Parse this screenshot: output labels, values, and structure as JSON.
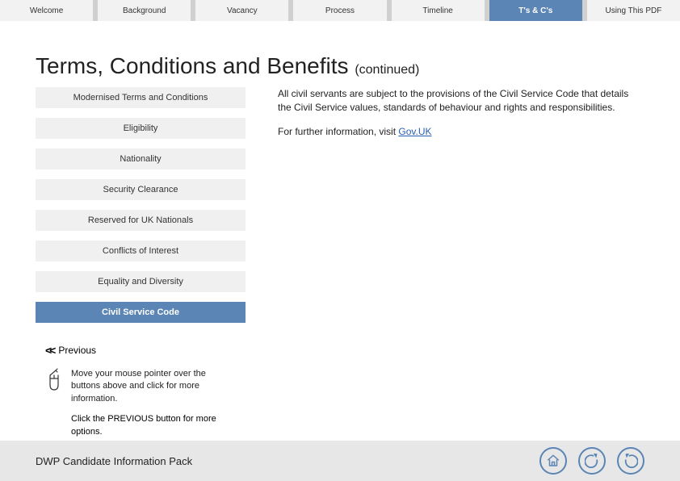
{
  "nav": {
    "tabs": [
      {
        "label": "Welcome"
      },
      {
        "label": "Background"
      },
      {
        "label": "Vacancy"
      },
      {
        "label": "Process"
      },
      {
        "label": "Timeline"
      },
      {
        "label": "T's & C's"
      },
      {
        "label": "Using This PDF"
      }
    ],
    "activeIndex": 5
  },
  "title": "Terms, Conditions and Benefits",
  "titleSuffix": "(continued)",
  "side": {
    "items": [
      {
        "label": "Modernised Terms and Conditions"
      },
      {
        "label": "Eligibility"
      },
      {
        "label": "Nationality"
      },
      {
        "label": "Security Clearance"
      },
      {
        "label": "Reserved for UK Nationals"
      },
      {
        "label": "Conflicts of Interest"
      },
      {
        "label": "Equality and Diversity"
      },
      {
        "label": "Civil Service Code"
      }
    ],
    "activeIndex": 7
  },
  "body": {
    "para1": "All civil servants are subject to the provisions of the Civil Service Code that details the Civil Service values, standards of behaviour and rights and responsibilities.",
    "para2_prefix": "For further information, visit ",
    "para2_link": "Gov.UK"
  },
  "prev": {
    "label": "Previous"
  },
  "hint1": "Move your mouse pointer over the buttons above and click for more information.",
  "hint2": "Click the PREVIOUS button for more options.",
  "footer": {
    "title": "DWP Candidate Information Pack",
    "home": "home-icon",
    "back": "back-icon",
    "forward": "forward-icon"
  }
}
